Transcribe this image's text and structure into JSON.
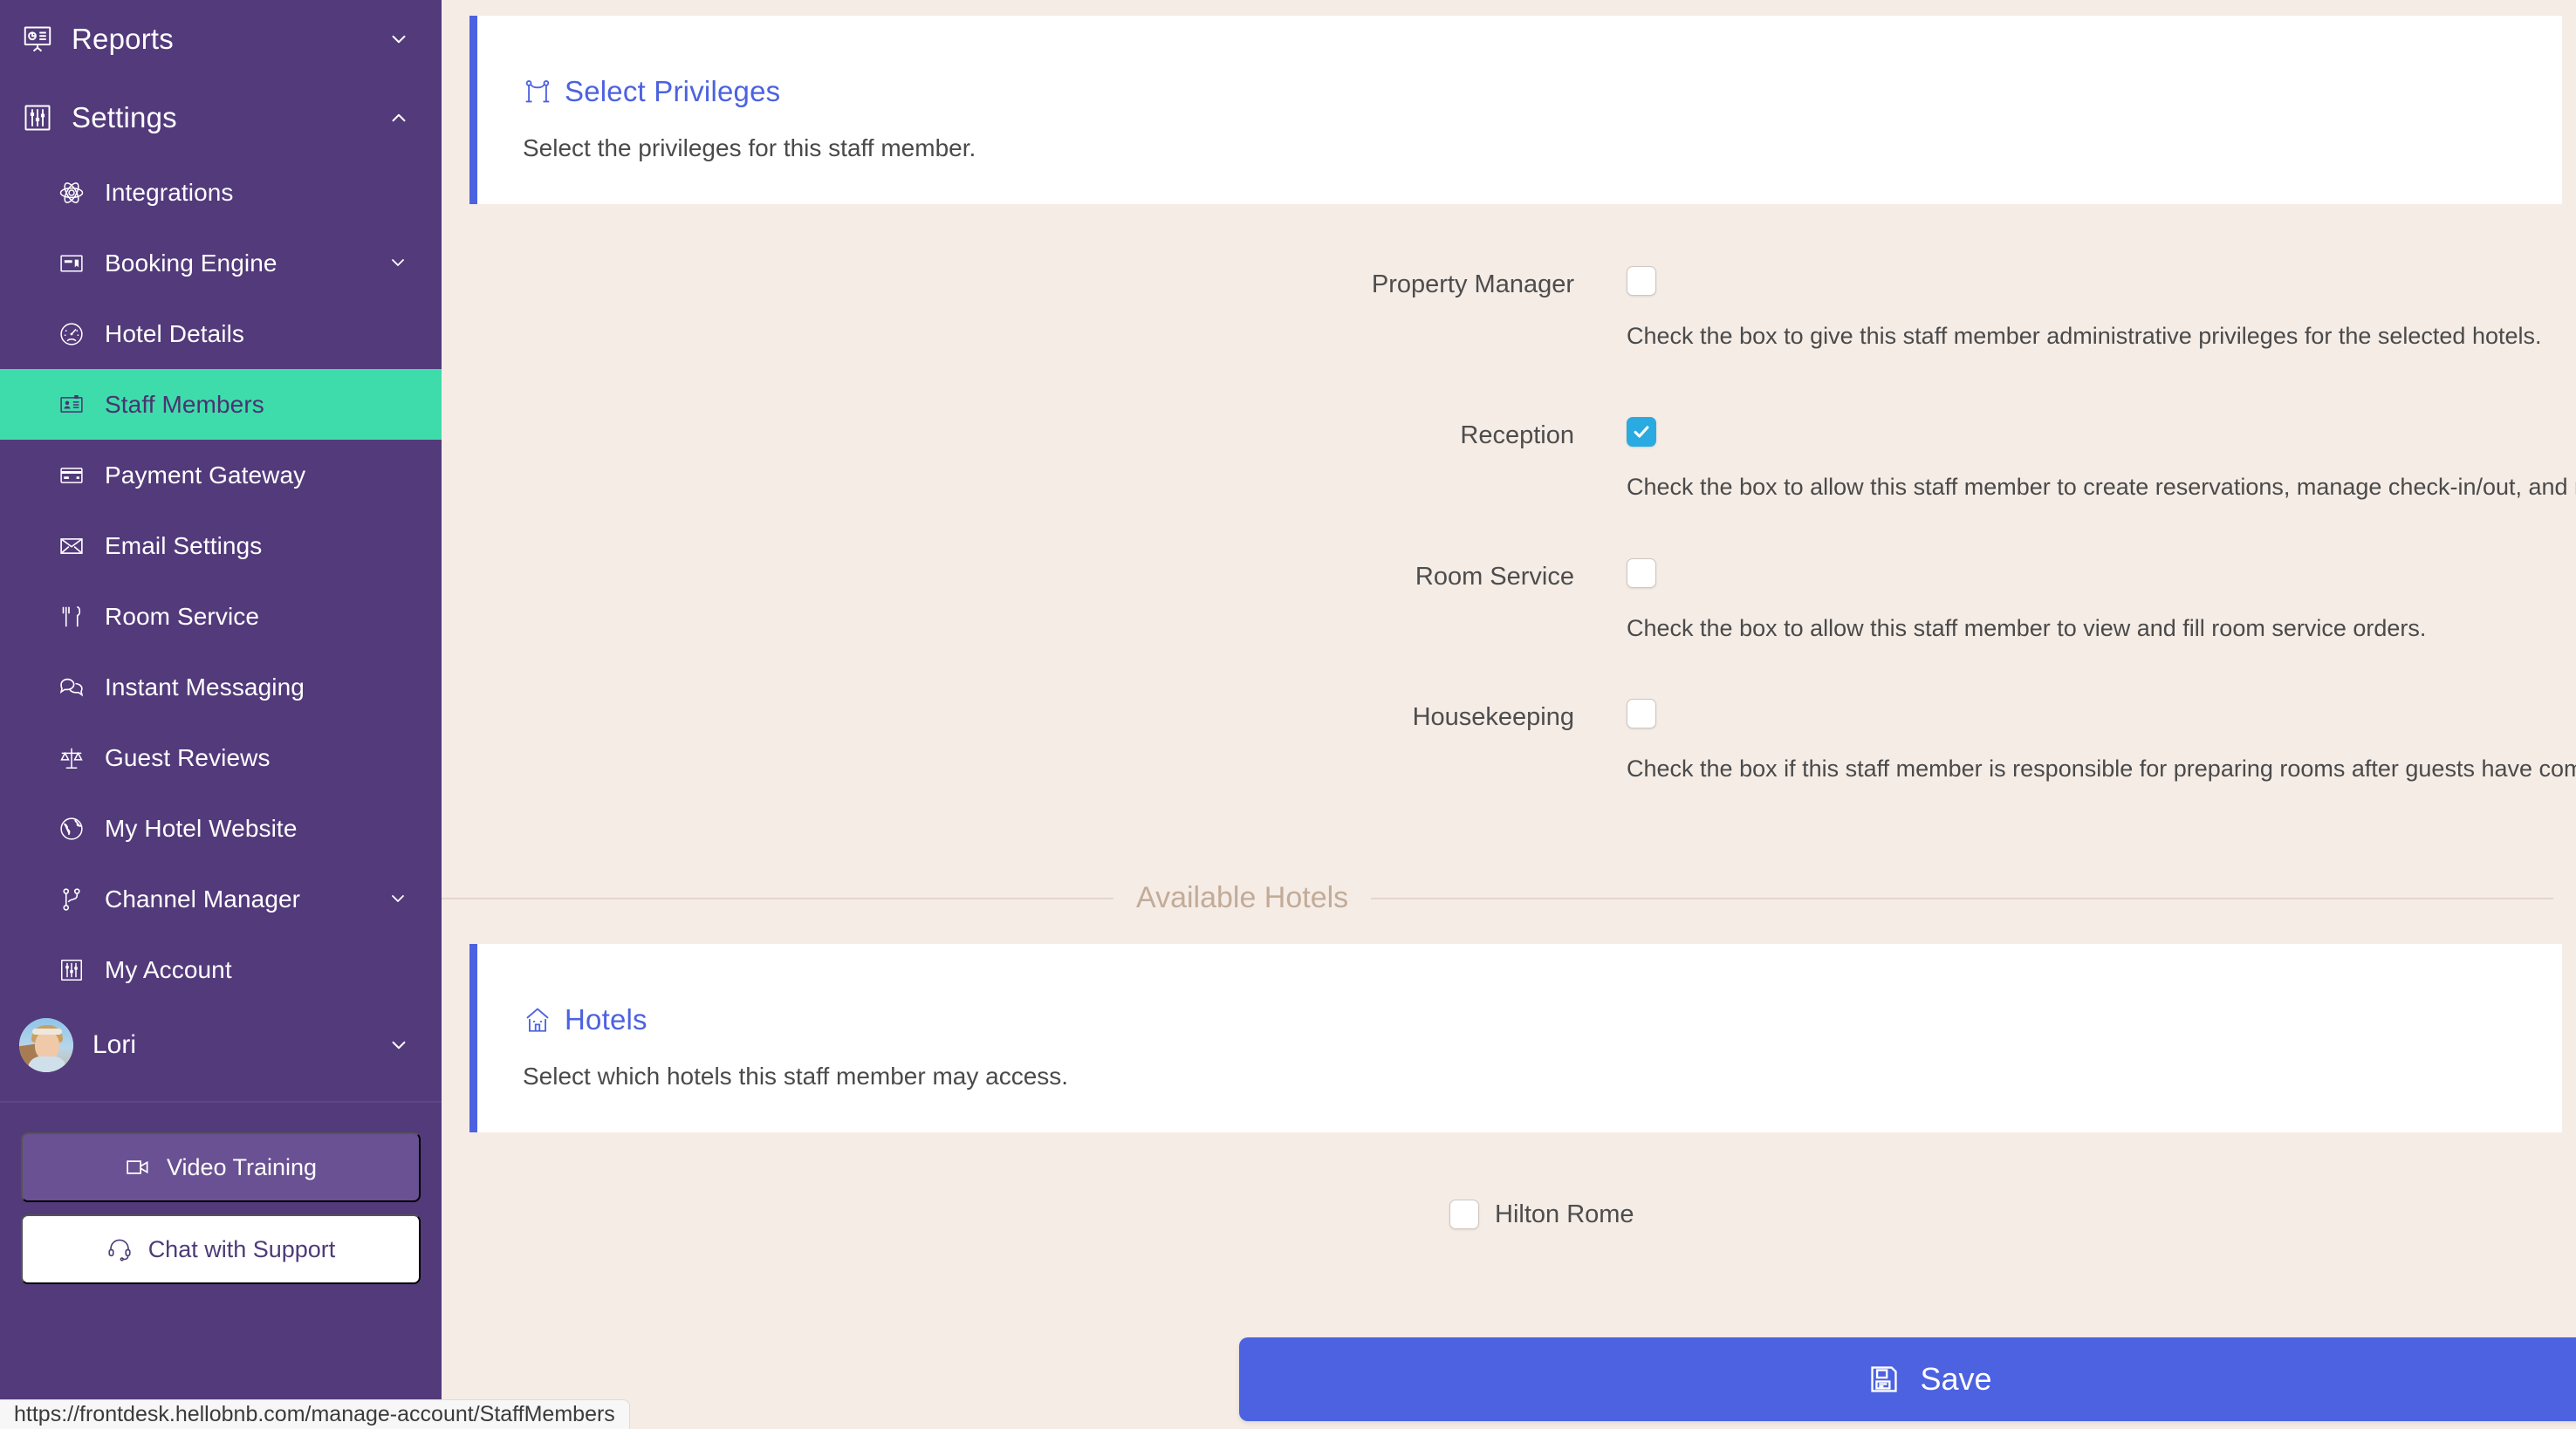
{
  "sidebar": {
    "groups": [
      {
        "id": "reports",
        "label": "Reports",
        "icon": "presentation-chart-icon",
        "chevron": "chevron-down-icon"
      },
      {
        "id": "settings",
        "label": "Settings",
        "icon": "sliders-icon",
        "chevron": "chevron-up-icon"
      }
    ],
    "items": [
      {
        "id": "integrations",
        "label": "Integrations",
        "icon": "atom-icon",
        "chevron": null,
        "active": false
      },
      {
        "id": "booking-engine",
        "label": "Booking Engine",
        "icon": "booking-card-icon",
        "chevron": "chevron-down-icon",
        "active": false
      },
      {
        "id": "hotel-details",
        "label": "Hotel Details",
        "icon": "gauge-icon",
        "chevron": null,
        "active": false
      },
      {
        "id": "staff-members",
        "label": "Staff Members",
        "icon": "id-card-icon",
        "chevron": null,
        "active": true
      },
      {
        "id": "payment-gateway",
        "label": "Payment Gateway",
        "icon": "credit-card-icon",
        "chevron": null,
        "active": false
      },
      {
        "id": "email-settings",
        "label": "Email Settings",
        "icon": "envelope-icon",
        "chevron": null,
        "active": false
      },
      {
        "id": "room-service",
        "label": "Room Service",
        "icon": "cutlery-icon",
        "chevron": null,
        "active": false
      },
      {
        "id": "instant-messaging",
        "label": "Instant Messaging",
        "icon": "chat-bubbles-icon",
        "chevron": null,
        "active": false
      },
      {
        "id": "guest-reviews",
        "label": "Guest Reviews",
        "icon": "scales-icon",
        "chevron": null,
        "active": false
      },
      {
        "id": "my-hotel-website",
        "label": "My Hotel Website",
        "icon": "globe-icon",
        "chevron": null,
        "active": false
      },
      {
        "id": "channel-manager",
        "label": "Channel Manager",
        "icon": "branch-icon",
        "chevron": "chevron-down-icon",
        "active": false
      },
      {
        "id": "my-account",
        "label": "My Account",
        "icon": "sliders-icon",
        "chevron": null,
        "active": false
      }
    ],
    "user": {
      "name": "Lori",
      "avatar": "user-avatar",
      "chevron": "chevron-down-icon"
    },
    "video_training_label": "Video Training",
    "video_training_icon": "video-camera-icon",
    "chat_support_label": "Chat with Support",
    "chat_support_icon": "headset-icon",
    "colors": {
      "bg": "#533a7b",
      "active_bg": "#3edcab",
      "active_text": "#4a3370"
    }
  },
  "privileges_card": {
    "title": "Select Privileges",
    "icon": "velvet-rope-icon",
    "subtitle": "Select the privileges for this staff member."
  },
  "privileges": [
    {
      "id": "property-manager",
      "label": "Property Manager",
      "checked": false,
      "help": "Check the box to give this staff member administrative privileges for the selected hotels."
    },
    {
      "id": "reception",
      "label": "Reception",
      "checked": true,
      "help": "Check the box to allow this staff member to create reservations, manage check-in/out, and register guests."
    },
    {
      "id": "room-service",
      "label": "Room Service",
      "checked": false,
      "help": "Check the box to allow this staff member to view and fill room service orders."
    },
    {
      "id": "housekeeping",
      "label": "Housekeeping",
      "checked": false,
      "help": "Check the box if this staff member is responsible for preparing rooms after guests have completed checkout."
    }
  ],
  "section_divider": {
    "label": "Available Hotels"
  },
  "hotels_card": {
    "title": "Hotels",
    "icon": "house-icon",
    "subtitle": "Select which hotels this staff member may access."
  },
  "hotels": [
    {
      "id": "hilton-rome",
      "label": "Hilton Rome",
      "checked": false
    }
  ],
  "save": {
    "label": "Save",
    "icon": "floppy-disk-icon",
    "color": "#4c62e0"
  },
  "status_bar": {
    "url": "https://frontdesk.hellobnb.com/manage-account/StaffMembers"
  },
  "colors": {
    "page_bg": "#f5ece6",
    "card_accent": "#4c62e0",
    "checkbox_checked": "#29abe2",
    "divider": "#e3d6cc",
    "divider_text": "#c2ab98"
  }
}
